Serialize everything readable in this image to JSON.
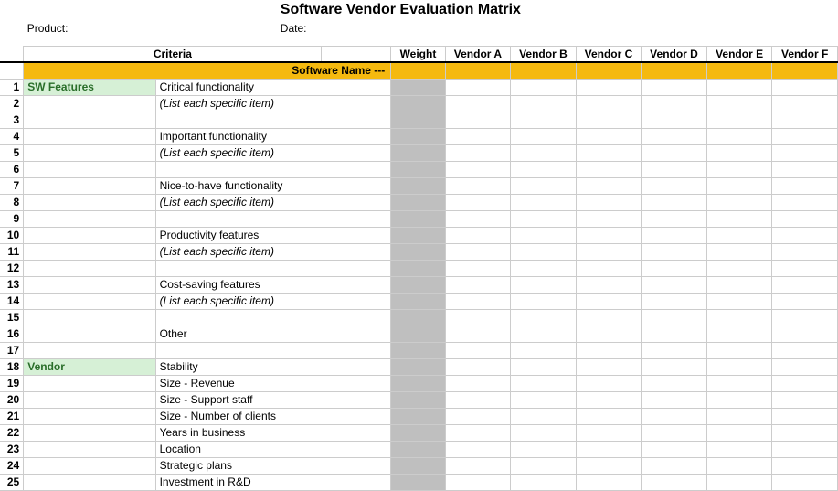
{
  "title": "Software Vendor Evaluation Matrix",
  "labels": {
    "product": "Product:",
    "date": "Date:",
    "criteria": "Criteria",
    "weight": "Weight",
    "software_name": "Software Name ---"
  },
  "vendors": [
    "Vendor A",
    "Vendor B",
    "Vendor C",
    "Vendor D",
    "Vendor E",
    "Vendor F"
  ],
  "rows": [
    {
      "n": 1,
      "cat": "SW Features",
      "crit": "Critical functionality",
      "cat_hl": true
    },
    {
      "n": 2,
      "cat": "",
      "crit": "(List each specific item)",
      "italic": true
    },
    {
      "n": 3,
      "cat": "",
      "crit": ""
    },
    {
      "n": 4,
      "cat": "",
      "crit": "Important functionality"
    },
    {
      "n": 5,
      "cat": "",
      "crit": "(List each specific item)",
      "italic": true
    },
    {
      "n": 6,
      "cat": "",
      "crit": ""
    },
    {
      "n": 7,
      "cat": "",
      "crit": "Nice-to-have functionality"
    },
    {
      "n": 8,
      "cat": "",
      "crit": "(List each specific item)",
      "italic": true
    },
    {
      "n": 9,
      "cat": "",
      "crit": ""
    },
    {
      "n": 10,
      "cat": "",
      "crit": "Productivity features"
    },
    {
      "n": 11,
      "cat": "",
      "crit": "(List each specific item)",
      "italic": true
    },
    {
      "n": 12,
      "cat": "",
      "crit": ""
    },
    {
      "n": 13,
      "cat": "",
      "crit": "Cost-saving features"
    },
    {
      "n": 14,
      "cat": "",
      "crit": "(List each specific item)",
      "italic": true
    },
    {
      "n": 15,
      "cat": "",
      "crit": ""
    },
    {
      "n": 16,
      "cat": "",
      "crit": "Other"
    },
    {
      "n": 17,
      "cat": "",
      "crit": ""
    },
    {
      "n": 18,
      "cat": "Vendor",
      "crit": "Stability",
      "cat_hl": true
    },
    {
      "n": 19,
      "cat": "",
      "crit": "Size - Revenue"
    },
    {
      "n": 20,
      "cat": "",
      "crit": "Size - Support staff"
    },
    {
      "n": 21,
      "cat": "",
      "crit": "Size - Number of clients"
    },
    {
      "n": 22,
      "cat": "",
      "crit": "Years in business"
    },
    {
      "n": 23,
      "cat": "",
      "crit": "Location"
    },
    {
      "n": 24,
      "cat": "",
      "crit": "Strategic plans"
    },
    {
      "n": 25,
      "cat": "",
      "crit": "Investment in R&D"
    }
  ]
}
